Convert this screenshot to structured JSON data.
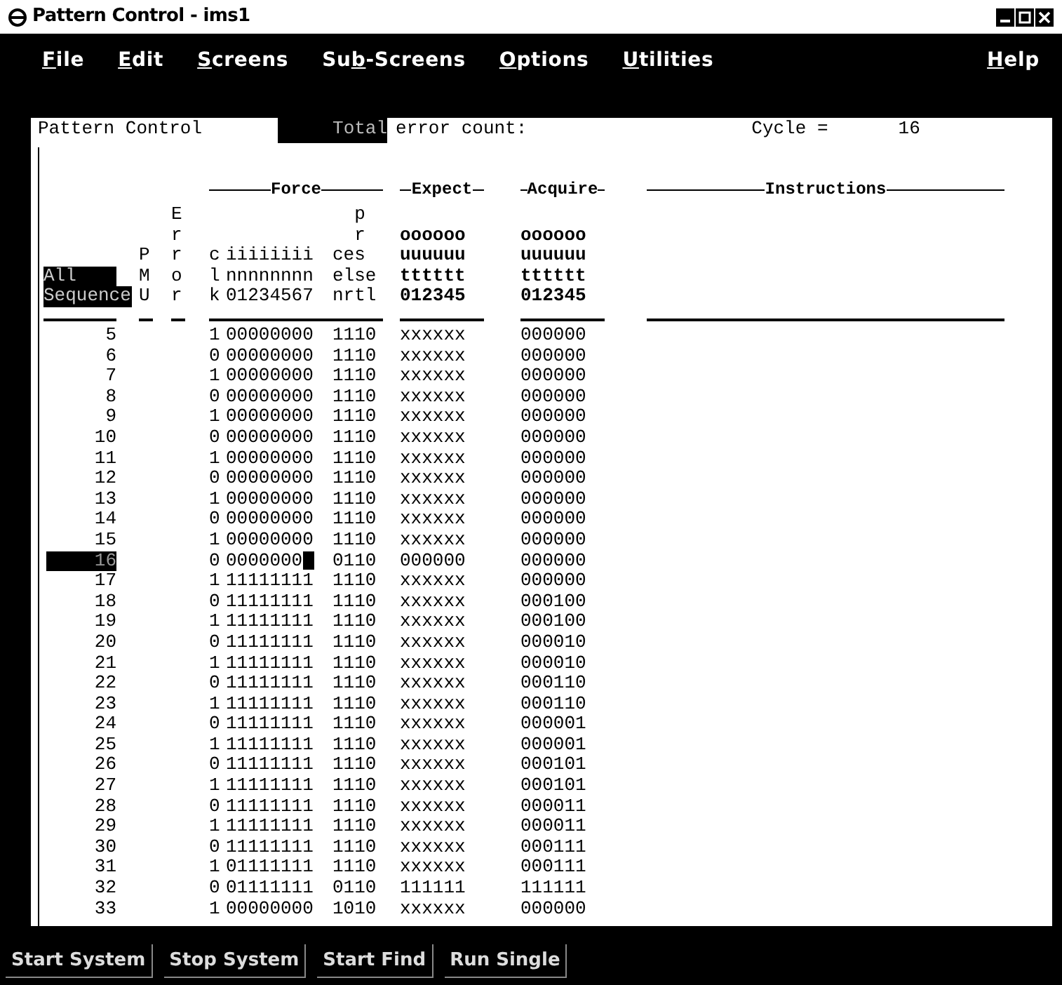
{
  "window": {
    "title": "Pattern Control - ims1"
  },
  "menu": [
    {
      "key": "F",
      "post": "ile"
    },
    {
      "key": "E",
      "post": "dit"
    },
    {
      "key": "S",
      "post": "creens"
    },
    {
      "pre": "Su",
      "key": "b",
      "post": "-Screens"
    },
    {
      "key": "O",
      "post": "ptions"
    },
    {
      "key": "U",
      "post": "tilities"
    }
  ],
  "help_menu": {
    "key": "H",
    "post": "elp"
  },
  "panel": {
    "title": "Pattern Control",
    "total_label": "Total",
    "error_label": "error count:",
    "cycle_label": "Cycle =",
    "cycle": "16"
  },
  "groups": {
    "force": "Force",
    "expect": "Expect",
    "acquire": "Acquire",
    "instructions": "Instructions"
  },
  "header": {
    "sequence": [
      "All",
      "Sequence"
    ],
    "pmu": [
      "P",
      "M",
      "U"
    ],
    "error": [
      "E",
      "r",
      "r",
      "o",
      "r"
    ],
    "clk": [
      "c",
      "l",
      "k"
    ],
    "force": [
      "iiiiiiii",
      "nnnnnnnn",
      "01234567"
    ],
    "proc": [
      "  p",
      "  r",
      "ces",
      "else",
      "nrtl"
    ],
    "expect": [
      "oooooo",
      "uuuuuu",
      "tttttt",
      "012345"
    ],
    "acquire": [
      "oooooo",
      "uuuuuu",
      "tttttt",
      "012345"
    ]
  },
  "rows": [
    {
      "seq": "5",
      "clk": "1",
      "force": "00000000",
      "proc": "1110",
      "expect": "xxxxxx",
      "acquire": "000000",
      "selected": false
    },
    {
      "seq": "6",
      "clk": "0",
      "force": "00000000",
      "proc": "1110",
      "expect": "xxxxxx",
      "acquire": "000000",
      "selected": false
    },
    {
      "seq": "7",
      "clk": "1",
      "force": "00000000",
      "proc": "1110",
      "expect": "xxxxxx",
      "acquire": "000000",
      "selected": false
    },
    {
      "seq": "8",
      "clk": "0",
      "force": "00000000",
      "proc": "1110",
      "expect": "xxxxxx",
      "acquire": "000000",
      "selected": false
    },
    {
      "seq": "9",
      "clk": "1",
      "force": "00000000",
      "proc": "1110",
      "expect": "xxxxxx",
      "acquire": "000000",
      "selected": false
    },
    {
      "seq": "10",
      "clk": "0",
      "force": "00000000",
      "proc": "1110",
      "expect": "xxxxxx",
      "acquire": "000000",
      "selected": false
    },
    {
      "seq": "11",
      "clk": "1",
      "force": "00000000",
      "proc": "1110",
      "expect": "xxxxxx",
      "acquire": "000000",
      "selected": false
    },
    {
      "seq": "12",
      "clk": "0",
      "force": "00000000",
      "proc": "1110",
      "expect": "xxxxxx",
      "acquire": "000000",
      "selected": false
    },
    {
      "seq": "13",
      "clk": "1",
      "force": "00000000",
      "proc": "1110",
      "expect": "xxxxxx",
      "acquire": "000000",
      "selected": false
    },
    {
      "seq": "14",
      "clk": "0",
      "force": "00000000",
      "proc": "1110",
      "expect": "xxxxxx",
      "acquire": "000000",
      "selected": false
    },
    {
      "seq": "15",
      "clk": "1",
      "force": "00000000",
      "proc": "1110",
      "expect": "xxxxxx",
      "acquire": "000000",
      "selected": false
    },
    {
      "seq": "16",
      "clk": "0",
      "force": "0000000",
      "proc": "0110",
      "expect": "000000",
      "acquire": "000000",
      "selected": true
    },
    {
      "seq": "17",
      "clk": "1",
      "force": "11111111",
      "proc": "1110",
      "expect": "xxxxxx",
      "acquire": "000000",
      "selected": false
    },
    {
      "seq": "18",
      "clk": "0",
      "force": "11111111",
      "proc": "1110",
      "expect": "xxxxxx",
      "acquire": "000100",
      "selected": false
    },
    {
      "seq": "19",
      "clk": "1",
      "force": "11111111",
      "proc": "1110",
      "expect": "xxxxxx",
      "acquire": "000100",
      "selected": false
    },
    {
      "seq": "20",
      "clk": "0",
      "force": "11111111",
      "proc": "1110",
      "expect": "xxxxxx",
      "acquire": "000010",
      "selected": false
    },
    {
      "seq": "21",
      "clk": "1",
      "force": "11111111",
      "proc": "1110",
      "expect": "xxxxxx",
      "acquire": "000010",
      "selected": false
    },
    {
      "seq": "22",
      "clk": "0",
      "force": "11111111",
      "proc": "1110",
      "expect": "xxxxxx",
      "acquire": "000110",
      "selected": false
    },
    {
      "seq": "23",
      "clk": "1",
      "force": "11111111",
      "proc": "1110",
      "expect": "xxxxxx",
      "acquire": "000110",
      "selected": false
    },
    {
      "seq": "24",
      "clk": "0",
      "force": "11111111",
      "proc": "1110",
      "expect": "xxxxxx",
      "acquire": "000001",
      "selected": false
    },
    {
      "seq": "25",
      "clk": "1",
      "force": "11111111",
      "proc": "1110",
      "expect": "xxxxxx",
      "acquire": "000001",
      "selected": false
    },
    {
      "seq": "26",
      "clk": "0",
      "force": "11111111",
      "proc": "1110",
      "expect": "xxxxxx",
      "acquire": "000101",
      "selected": false
    },
    {
      "seq": "27",
      "clk": "1",
      "force": "11111111",
      "proc": "1110",
      "expect": "xxxxxx",
      "acquire": "000101",
      "selected": false
    },
    {
      "seq": "28",
      "clk": "0",
      "force": "11111111",
      "proc": "1110",
      "expect": "xxxxxx",
      "acquire": "000011",
      "selected": false
    },
    {
      "seq": "29",
      "clk": "1",
      "force": "11111111",
      "proc": "1110",
      "expect": "xxxxxx",
      "acquire": "000011",
      "selected": false
    },
    {
      "seq": "30",
      "clk": "0",
      "force": "11111111",
      "proc": "1110",
      "expect": "xxxxxx",
      "acquire": "000111",
      "selected": false
    },
    {
      "seq": "31",
      "clk": "1",
      "force": "01111111",
      "proc": "1110",
      "expect": "xxxxxx",
      "acquire": "000111",
      "selected": false
    },
    {
      "seq": "32",
      "clk": "0",
      "force": "01111111",
      "proc": "0110",
      "expect": "111111",
      "acquire": "111111",
      "selected": false
    },
    {
      "seq": "33",
      "clk": "1",
      "force": "00000000",
      "proc": "1010",
      "expect": "xxxxxx",
      "acquire": "000000",
      "selected": false
    }
  ],
  "buttons": [
    "Start System",
    "Stop System",
    "Start Find",
    "Run Single"
  ]
}
